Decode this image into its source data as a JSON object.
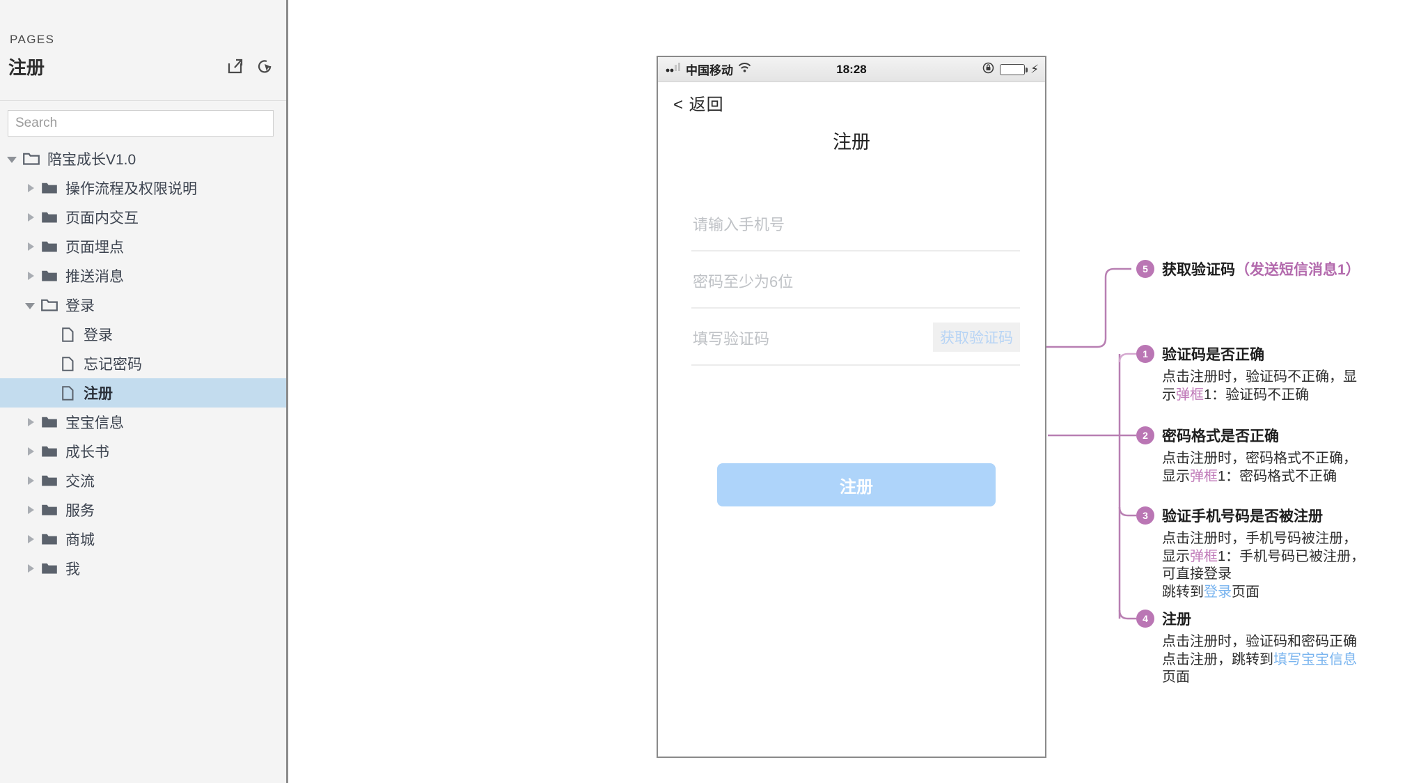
{
  "sidebar": {
    "section_label": "PAGES",
    "page_title": "注册",
    "icons": [
      {
        "name": "export-icon"
      },
      {
        "name": "preview-icon"
      }
    ],
    "search": {
      "placeholder": "Search",
      "value": ""
    },
    "tree": [
      {
        "label": "陪宝成长V1.0",
        "depth": 0,
        "type": "folder-open",
        "twisty": "expanded",
        "selected": false
      },
      {
        "label": "操作流程及权限说明",
        "depth": 1,
        "type": "folder",
        "twisty": "collapsed",
        "selected": false
      },
      {
        "label": "页面内交互",
        "depth": 1,
        "type": "folder",
        "twisty": "collapsed",
        "selected": false
      },
      {
        "label": "页面埋点",
        "depth": 1,
        "type": "folder",
        "twisty": "collapsed",
        "selected": false
      },
      {
        "label": "推送消息",
        "depth": 1,
        "type": "folder",
        "twisty": "collapsed",
        "selected": false
      },
      {
        "label": "登录",
        "depth": 1,
        "type": "folder-open",
        "twisty": "expanded",
        "selected": false
      },
      {
        "label": "登录",
        "depth": 2,
        "type": "page",
        "twisty": "none",
        "selected": false
      },
      {
        "label": "忘记密码",
        "depth": 2,
        "type": "page",
        "twisty": "none",
        "selected": false
      },
      {
        "label": "注册",
        "depth": 2,
        "type": "page",
        "twisty": "none",
        "selected": true
      },
      {
        "label": "宝宝信息",
        "depth": 1,
        "type": "folder",
        "twisty": "collapsed",
        "selected": false
      },
      {
        "label": "成长书",
        "depth": 1,
        "type": "folder",
        "twisty": "collapsed",
        "selected": false
      },
      {
        "label": "交流",
        "depth": 1,
        "type": "folder",
        "twisty": "collapsed",
        "selected": false
      },
      {
        "label": "服务",
        "depth": 1,
        "type": "folder",
        "twisty": "collapsed",
        "selected": false
      },
      {
        "label": "商城",
        "depth": 1,
        "type": "folder",
        "twisty": "collapsed",
        "selected": false
      },
      {
        "label": "我",
        "depth": 1,
        "type": "folder",
        "twisty": "collapsed",
        "selected": false
      }
    ]
  },
  "phone": {
    "statusbar": {
      "carrier": "中国移动",
      "time": "18:28",
      "signal_icon": "signal-bars-icon",
      "wifi_icon": "wifi-icon",
      "rotation_lock_icon": "rotation-lock-icon",
      "battery_icon": "battery-icon",
      "charging_icon": "⚡",
      "battery_color": "#2ee83c"
    },
    "back_label": "< 返回",
    "title": "注册",
    "fields": [
      {
        "name": "phone-input",
        "placeholder": "请输入手机号",
        "value": ""
      },
      {
        "name": "password-input",
        "placeholder": "密码至少为6位",
        "value": ""
      },
      {
        "name": "code-input",
        "placeholder": "填写验证码",
        "value": ""
      }
    ],
    "get_code_label": "获取验证码",
    "register_label": "注册",
    "register_color": "#aed4fa"
  },
  "annotations": {
    "badge_color": "#ba76b4",
    "items": [
      {
        "number": "5",
        "title_main": "获取验证码",
        "title_paren": "（发送短信消息1）",
        "lines": []
      },
      {
        "number": "1",
        "title_main": "验证码是否正确",
        "title_paren": "",
        "lines": [
          [
            {
              "t": "点击注册时，验证码不正确，显",
              "c": "plain"
            }
          ],
          [
            {
              "t": "示",
              "c": "plain"
            },
            {
              "t": "弹框",
              "c": "pink"
            },
            {
              "t": "1：验证码不正确",
              "c": "plain"
            }
          ]
        ]
      },
      {
        "number": "2",
        "title_main": "密码格式是否正确",
        "title_paren": "",
        "lines": [
          [
            {
              "t": "点击注册时，密码格式不正确，",
              "c": "plain"
            }
          ],
          [
            {
              "t": "显示",
              "c": "plain"
            },
            {
              "t": "弹框",
              "c": "pink"
            },
            {
              "t": "1：密码格式不正确",
              "c": "plain"
            }
          ]
        ]
      },
      {
        "number": "3",
        "title_main": "验证手机号码是否被注册",
        "title_paren": "",
        "lines": [
          [
            {
              "t": "点击注册时，手机号码被注册，",
              "c": "plain"
            }
          ],
          [
            {
              "t": "显示",
              "c": "plain"
            },
            {
              "t": "弹框",
              "c": "pink"
            },
            {
              "t": "1：手机号码已被注册，",
              "c": "plain"
            }
          ],
          [
            {
              "t": "可直接登录",
              "c": "plain"
            }
          ],
          [
            {
              "t": "跳转到",
              "c": "plain"
            },
            {
              "t": "登录",
              "c": "blue"
            },
            {
              "t": "页面",
              "c": "plain"
            }
          ]
        ]
      },
      {
        "number": "4",
        "title_main": "注册",
        "title_paren": "",
        "lines": [
          [
            {
              "t": "点击注册时，验证码和密码正确",
              "c": "plain"
            }
          ],
          [
            {
              "t": "点击注册，跳转到",
              "c": "plain"
            },
            {
              "t": "填写宝宝信息",
              "c": "blue"
            }
          ],
          [
            {
              "t": "页面",
              "c": "plain"
            }
          ]
        ]
      }
    ]
  }
}
